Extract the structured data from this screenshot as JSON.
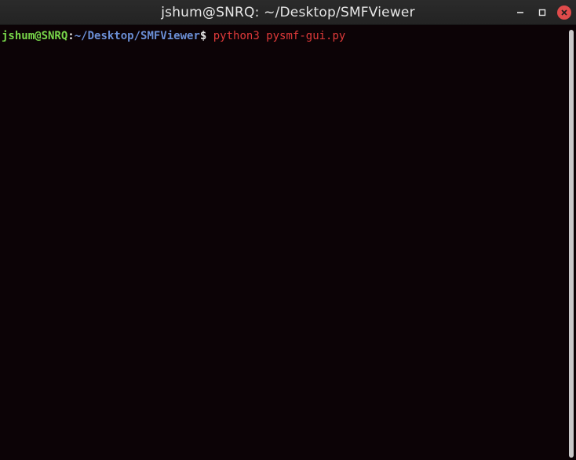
{
  "window": {
    "title": "jshum@SNRQ: ~/Desktop/SMFViewer"
  },
  "controls": {
    "minimize_icon": "minimize-icon",
    "maximize_icon": "maximize-icon",
    "close_icon": "close-icon"
  },
  "terminal": {
    "prompt_user": "jshum@SNRQ",
    "prompt_colon": ":",
    "prompt_path": "~/Desktop/SMFViewer",
    "prompt_symbol": "$",
    "command": " python3 pysmf-gui.py"
  },
  "colors": {
    "background": "#0c0306",
    "titlebar": "#262626",
    "prompt_user": "#78d64a",
    "prompt_path": "#6b8fd6",
    "command": "#e03a3a",
    "close_button": "#e04b4b",
    "scroll_thumb": "#c8c8c8"
  }
}
